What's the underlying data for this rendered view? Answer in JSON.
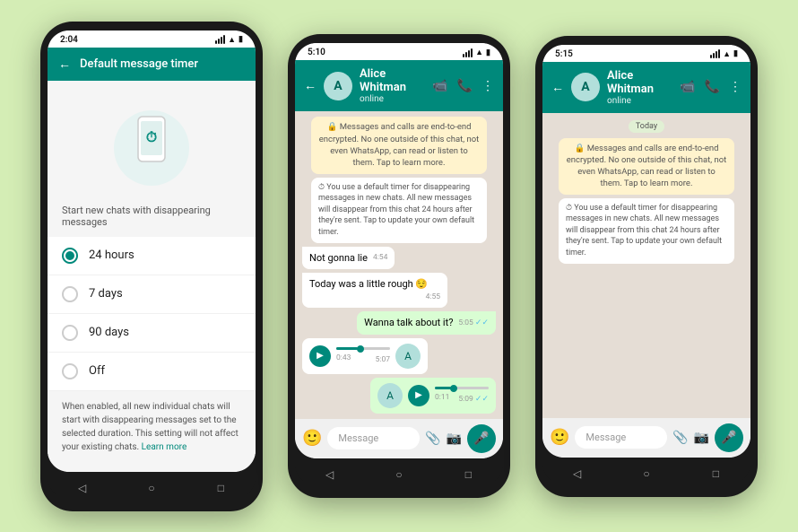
{
  "background": "#d4edb5",
  "phones": [
    {
      "id": "phone1",
      "time": "2:04",
      "type": "settings",
      "header": {
        "title": "Default message timer",
        "back_icon": "←"
      },
      "illustration_icon": "C",
      "subtitle": "Start new chats with disappearing messages",
      "options": [
        {
          "label": "24 hours",
          "selected": true
        },
        {
          "label": "7 days",
          "selected": false
        },
        {
          "label": "90 days",
          "selected": false
        },
        {
          "label": "Off",
          "selected": false
        }
      ],
      "footer": "When enabled, all new individual chats will start with disappearing messages set to the selected duration. This setting will not affect your existing chats.",
      "footer_link": "Learn more"
    },
    {
      "id": "phone2",
      "time": "5:10",
      "type": "chat",
      "contact": "Alice Whitman",
      "status": "online",
      "encryption_note": "🔒 Messages and calls are end-to-end encrypted. No one outside of this chat, not even WhatsApp, can read or listen to them. Tap to learn more.",
      "disappear_note": "⏱ You use a default timer for disappearing messages in new chats. All new messages will disappear from this chat 24 hours after they're sent. Tap to update your own default timer.",
      "messages": [
        {
          "type": "received",
          "text": "Not gonna lie",
          "time": "4:54"
        },
        {
          "type": "received",
          "text": "Today was a little rough 😌",
          "time": "4:55"
        },
        {
          "type": "sent",
          "text": "Wanna talk about it?",
          "time": "5:05",
          "ticks": "✓✓"
        },
        {
          "type": "audio_received",
          "duration": "0:43",
          "time": "5:07",
          "progress": 40
        },
        {
          "type": "audio_sent",
          "duration": "0:11",
          "time": "5:09",
          "ticks": "✓✓",
          "progress": 30
        }
      ],
      "input_placeholder": "Message"
    },
    {
      "id": "phone3",
      "time": "5:15",
      "type": "chat",
      "contact": "Alice Whitman",
      "status": "online",
      "encryption_note": "🔒 Messages and calls are end-to-end encrypted. No one outside of this chat, not even WhatsApp, can read or listen to them. Tap to learn more.",
      "disappear_note": "⏱ You use a default timer for disappearing messages in new chats. All new messages will disappear from this chat 24 hours after they're sent. Tap to update your own default timer.",
      "date_label": "Today",
      "input_placeholder": "Message"
    }
  ]
}
